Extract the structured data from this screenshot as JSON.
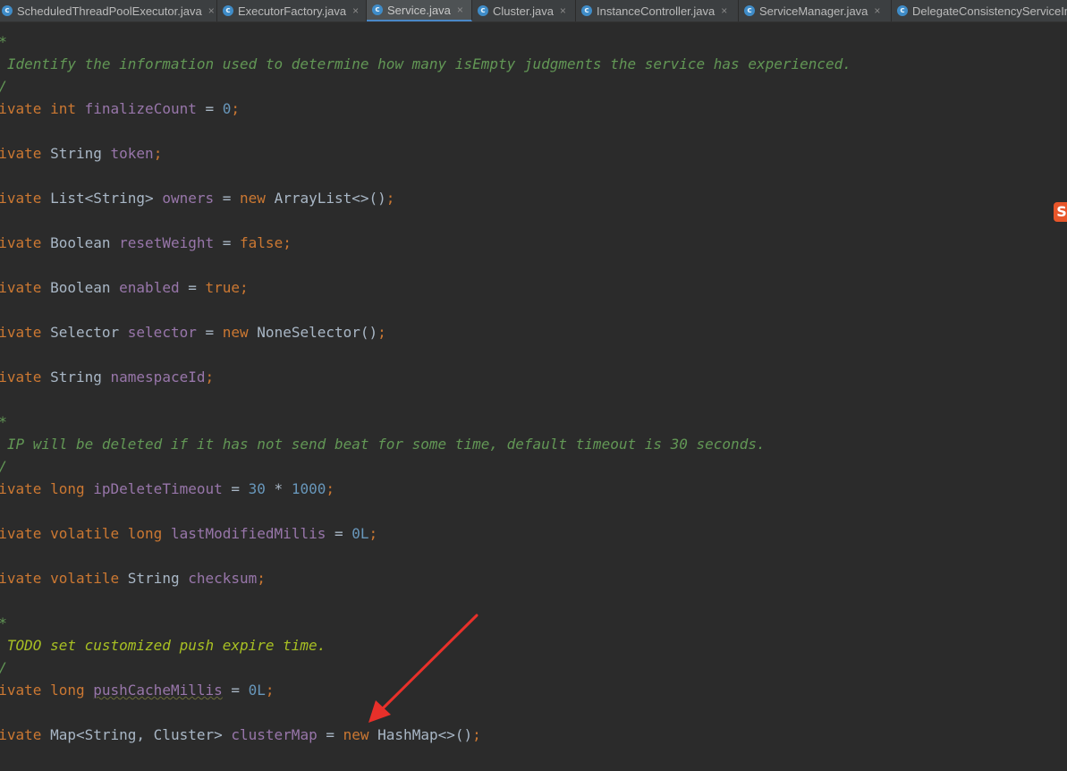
{
  "tabs": [
    {
      "label": "ScheduledThreadPoolExecutor.java",
      "icon": "class-lock-icon"
    },
    {
      "label": "ExecutorFactory.java",
      "icon": "class-icon"
    },
    {
      "label": "Service.java",
      "icon": "class-icon",
      "active": true
    },
    {
      "label": "Cluster.java",
      "icon": "class-icon"
    },
    {
      "label": "InstanceController.java",
      "icon": "class-icon"
    },
    {
      "label": "ServiceManager.java",
      "icon": "class-icon"
    },
    {
      "label": "DelegateConsistencyServiceIm",
      "icon": "class-icon"
    }
  ],
  "tab_close_glyph": "×",
  "class_icon_glyph": "c",
  "code": {
    "c1_open": "/**",
    "c1_body": " * Identify the information used to determine how many isEmpty judgments the service has experienced.",
    "c1_close": " */",
    "l_finalize": {
      "mod": "private",
      "type": "int",
      "name": "finalizeCount",
      "eq": " = ",
      "val": "0",
      "semi": ";"
    },
    "l_token": {
      "mod": "private",
      "type": "String",
      "name": "token",
      "semi": ";"
    },
    "l_owners": {
      "mod": "private",
      "type": "List<String>",
      "name": "owners",
      "eq": " = ",
      "kw": "new",
      "ctor": "ArrayList<>()",
      "semi": ";"
    },
    "l_reset": {
      "mod": "private",
      "type": "Boolean",
      "name": "resetWeight",
      "eq": " = ",
      "val": "false",
      "semi": ";"
    },
    "l_enabled": {
      "mod": "private",
      "type": "Boolean",
      "name": "enabled",
      "eq": " = ",
      "val": "true",
      "semi": ";"
    },
    "l_selector": {
      "mod": "private",
      "type": "Selector",
      "name": "selector",
      "eq": " = ",
      "kw": "new",
      "ctor": "NoneSelector()",
      "semi": ";"
    },
    "l_ns": {
      "mod": "private",
      "type": "String",
      "name": "namespaceId",
      "semi": ";"
    },
    "c2_open": "/**",
    "c2_body": " * IP will be deleted if it has not send beat for some time, default timeout is 30 seconds.",
    "c2_close": " */",
    "l_ipdel": {
      "mod": "private",
      "type": "long",
      "name": "ipDeleteTimeout",
      "eq": " = ",
      "v1": "30",
      "op": " * ",
      "v2": "1000",
      "semi": ";"
    },
    "l_lastmod": {
      "mod": "private",
      "mod2": "volatile",
      "type": "long",
      "name": "lastModifiedMillis",
      "eq": " = ",
      "val": "0L",
      "semi": ";"
    },
    "l_checksum": {
      "mod": "private",
      "mod2": "volatile",
      "type": "String",
      "name": "checksum",
      "semi": ";"
    },
    "c3_open": "/**",
    "c3_star": " * ",
    "c3_body": "TODO set customized push expire time.",
    "c3_close": " */",
    "l_push": {
      "mod": "private",
      "type": "long",
      "name": "pushCacheMillis",
      "eq": " = ",
      "val": "0L",
      "semi": ";"
    },
    "l_cluster": {
      "mod": "private",
      "type": "Map<String, Cluster>",
      "name": "clusterMap",
      "eq": " = ",
      "kw": "new",
      "ctor": "HashMap<>()",
      "semi": ";"
    }
  },
  "overlay": {
    "ime_badge": "S"
  },
  "colors": {
    "background": "#2b2b2b",
    "comment": "#629755",
    "todo": "#a8c023",
    "keyword": "#cc7832",
    "field": "#9876aa",
    "number": "#6897bb",
    "text": "#a9b7c6",
    "arrow": "#e8302a"
  }
}
